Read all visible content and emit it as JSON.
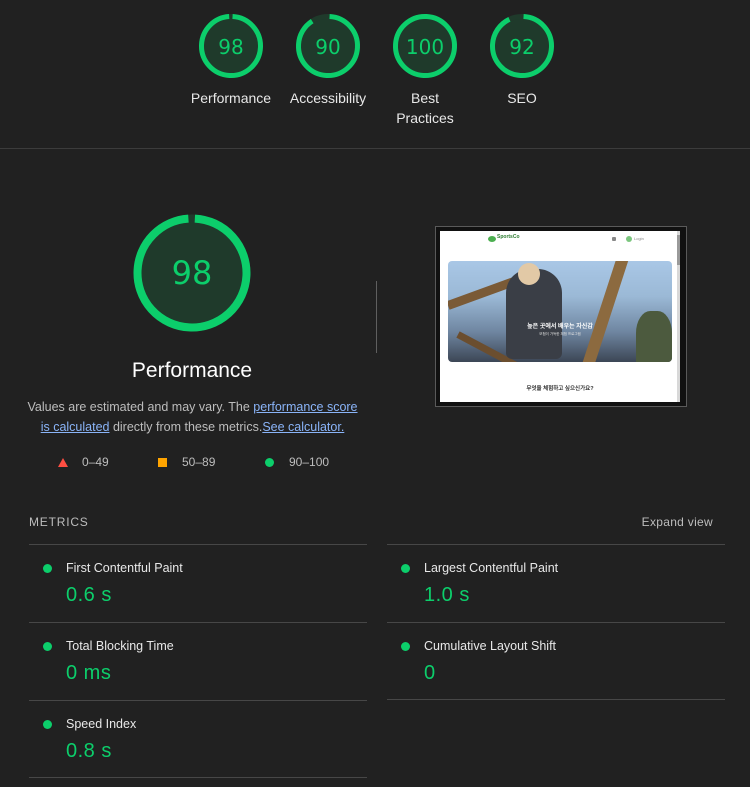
{
  "summary": {
    "items": [
      {
        "score": "98",
        "label_line1": "Performance",
        "label_line2": ""
      },
      {
        "score": "90",
        "label_line1": "Accessibility",
        "label_line2": ""
      },
      {
        "score": "100",
        "label_line1": "Best",
        "label_line2": "Practices"
      },
      {
        "score": "92",
        "label_line1": "SEO",
        "label_line2": ""
      }
    ],
    "score_values": [
      98,
      90,
      100,
      92
    ]
  },
  "performance": {
    "score": "98",
    "score_value": 98,
    "title": "Performance",
    "desc_prefix": "Values are estimated and may vary. The ",
    "desc_link1": "performance score is calculated",
    "desc_middle": " directly from these metrics.",
    "desc_link2": "See calculator."
  },
  "legend": {
    "fail": "0–49",
    "average": "50–89",
    "pass": "90–100"
  },
  "thumbnail": {
    "logo_text": "SportsCo",
    "nav_text": "Login",
    "hero_title": "높은 곳에서 배우는 자신감",
    "hero_subtitle": "모험이 가득한 체험 프로그램",
    "question": "무엇을 체험하고 싶으신가요?"
  },
  "metrics": {
    "title": "METRICS",
    "expand_label": "Expand view",
    "items": [
      {
        "label": "First Contentful Paint",
        "value": "0.6 s"
      },
      {
        "label": "Largest Contentful Paint",
        "value": "1.0 s"
      },
      {
        "label": "Total Blocking Time",
        "value": "0 ms"
      },
      {
        "label": "Cumulative Layout Shift",
        "value": "0"
      },
      {
        "label": "Speed Index",
        "value": "0.8 s"
      }
    ]
  },
  "colors": {
    "pass": "#0cce6b",
    "average": "#ffa400",
    "fail": "#ff4e42",
    "background": "#212121"
  }
}
